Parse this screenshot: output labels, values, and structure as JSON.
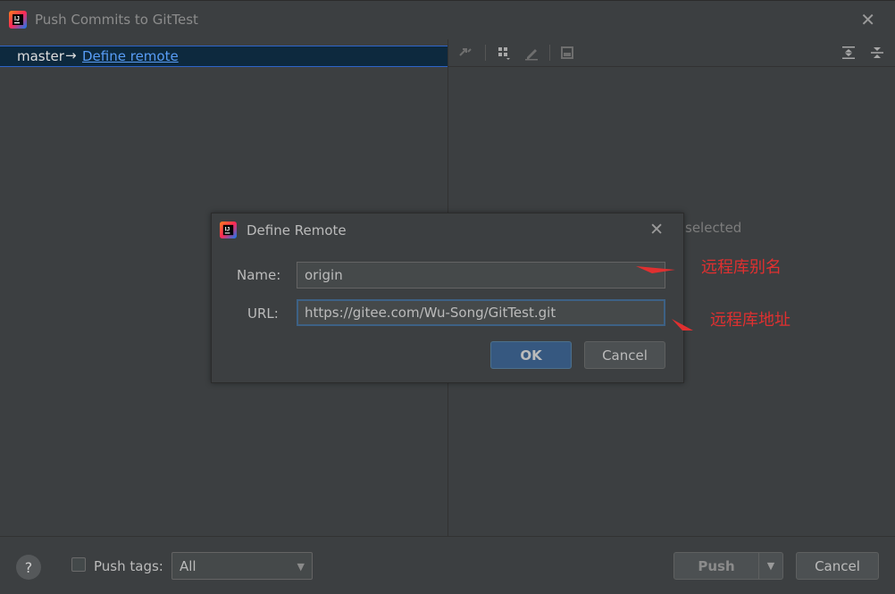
{
  "window": {
    "title": "Push Commits to GitTest"
  },
  "branch": {
    "name": "master",
    "arrow": "→",
    "define_remote_link": "Define remote"
  },
  "right_pane": {
    "empty_status": "selected"
  },
  "dialog": {
    "title": "Define Remote",
    "name_label": "Name:",
    "name_value": "origin",
    "url_label": "URL:",
    "url_value": "https://gitee.com/Wu-Song/GitTest.git",
    "ok_label": "OK",
    "cancel_label": "Cancel"
  },
  "annotations": {
    "name_note": "远程库别名",
    "url_note": "远程库地址"
  },
  "bottom": {
    "help_label": "?",
    "push_tags_label": "Push tags:",
    "tags_select_value": "All",
    "push_label": "Push",
    "cancel_label": "Cancel"
  },
  "colors": {
    "link": "#589df6",
    "annotation": "#e03030",
    "ok_button": "#365880",
    "selection": "#0d293e"
  }
}
